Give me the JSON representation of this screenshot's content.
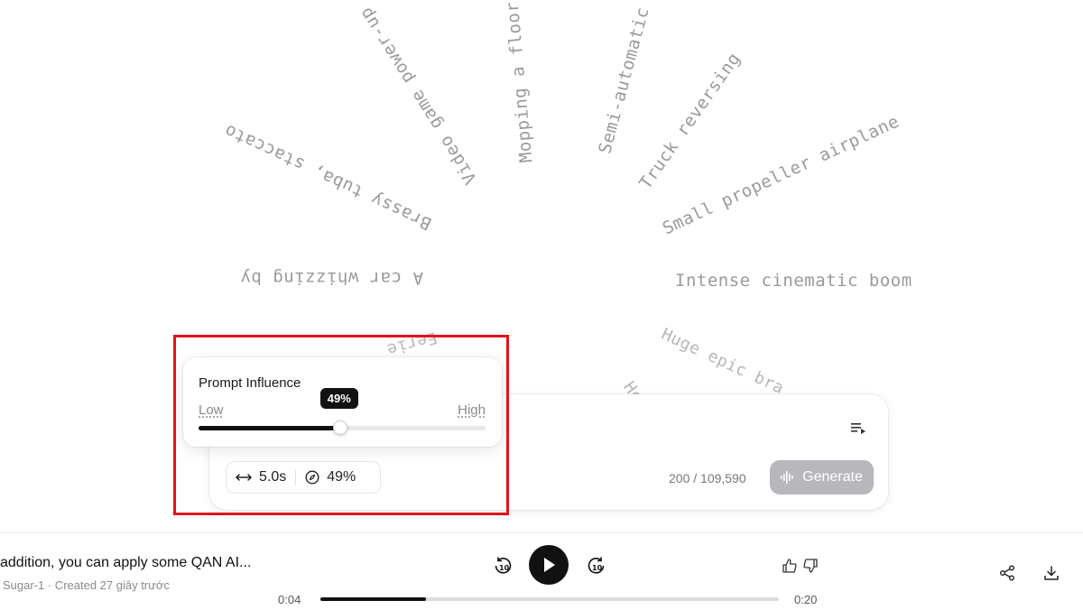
{
  "word_cloud": [
    "Video game power-up",
    "Mopping a floor",
    "Semi-automatic",
    "Truck reversing",
    "Brassy tuba, staccato",
    "Small propeller airplane",
    "A car whizzing by",
    "Intense cinematic boom",
    "Eerie",
    "Huge epic bra",
    "Ho"
  ],
  "prompt_influence": {
    "title": "Prompt Influence",
    "low_label": "Low",
    "high_label": "High",
    "value_label": "49%",
    "value_fraction": 0.49
  },
  "composer": {
    "duration": "5.0s",
    "influence": "49%",
    "char_count": "200 / 109,590",
    "generate_label": "Generate"
  },
  "player": {
    "title": "addition, you can apply some QAN AI...",
    "meta": "Sugar-1 · Created 27 giây trước",
    "elapsed": "0:04",
    "total": "0:20",
    "progress_fraction": 0.23
  },
  "colors": {
    "highlight": "#e0141b",
    "accent": "#111111",
    "generate_disabled": "#b8b8bc"
  }
}
